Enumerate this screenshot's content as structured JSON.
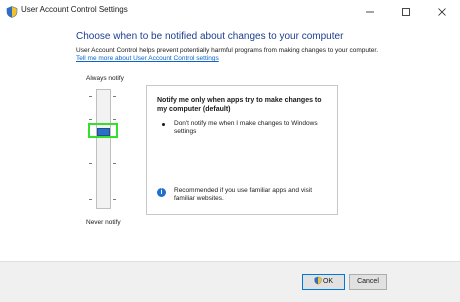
{
  "window": {
    "title": "User Account Control Settings",
    "app_icon": "uac-shield-icon"
  },
  "header": {
    "heading": "Choose when to be notified about changes to your computer",
    "description": "User Account Control helps prevent potentially harmful programs from making changes to your computer.",
    "help_link": "Tell me more about User Account Control settings"
  },
  "slider": {
    "top_label": "Always notify",
    "bottom_label": "Never notify",
    "selected_level": 3,
    "levels": 4
  },
  "info": {
    "heading": "Notify me only when apps try to make changes to my computer (default)",
    "bullet": "Don't notify me when I make changes to Windows settings",
    "recommendation": "Recommended if you use familiar apps and visit familiar websites.",
    "icon": "info-icon"
  },
  "buttons": {
    "ok_label": "OK",
    "cancel_label": "Cancel"
  },
  "colors": {
    "heading": "#1c3e91",
    "link": "#0b64c8",
    "highlight": "#33e02b",
    "thumb": "#2b6fc9"
  }
}
